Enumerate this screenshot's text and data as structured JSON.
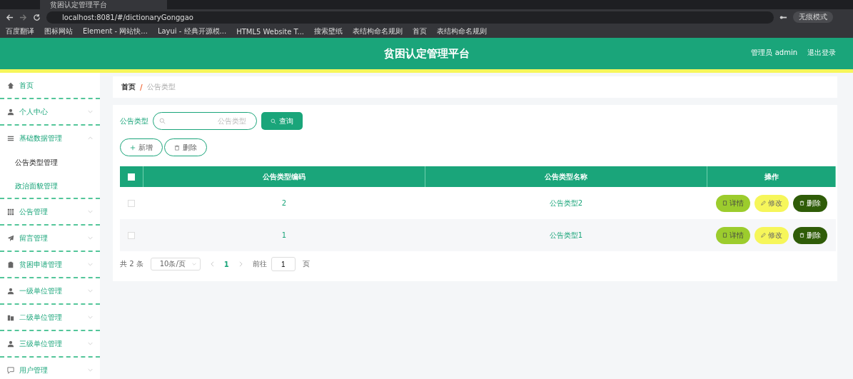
{
  "browser": {
    "tab_title": "贫困认定管理平台",
    "url": "localhost:8081/#/dictionaryGonggao",
    "profile": "无痕模式",
    "bookmarks": [
      "百度翻译",
      "图标网站",
      "Element - 网站快...",
      "Layui - 经典开源模...",
      "HTML5 Website T...",
      "搜索壁纸",
      "表结构命名规则",
      "首页",
      "表结构命名规则"
    ]
  },
  "header": {
    "title": "贫困认定管理平台",
    "user": "管理员 admin",
    "logout": "退出登录"
  },
  "sidebar": {
    "items": [
      {
        "label": "首页",
        "expandable": false,
        "expanded": false
      },
      {
        "label": "个人中心",
        "expandable": true,
        "expanded": false
      },
      {
        "label": "基础数据管理",
        "expandable": true,
        "expanded": true,
        "children": [
          {
            "label": "公告类型管理",
            "selected": true
          },
          {
            "label": "政治面貌管理",
            "selected": false
          }
        ]
      },
      {
        "label": "公告管理",
        "expandable": true,
        "expanded": false
      },
      {
        "label": "留言管理",
        "expandable": true,
        "expanded": false
      },
      {
        "label": "贫困申请管理",
        "expandable": true,
        "expanded": false
      },
      {
        "label": "一级单位管理",
        "expandable": true,
        "expanded": false
      },
      {
        "label": "二级单位管理",
        "expandable": true,
        "expanded": false
      },
      {
        "label": "三级单位管理",
        "expandable": true,
        "expanded": false
      },
      {
        "label": "用户管理",
        "expandable": true,
        "expanded": false
      }
    ]
  },
  "breadcrumb": {
    "separator": "/",
    "items": [
      "首页",
      "公告类型"
    ]
  },
  "search": {
    "label": "公告类型",
    "placeholder": "公告类型",
    "button": "查询"
  },
  "actions": [
    "新增",
    "删除"
  ],
  "table": {
    "header_checked": false,
    "columns": [
      "公告类型编码",
      "公告类型名称",
      "操作"
    ],
    "rows": [
      {
        "checked": false,
        "code": "2",
        "name": "公告类型2",
        "buttons": [
          "详情",
          "修改",
          "删除"
        ]
      },
      {
        "checked": false,
        "code": "1",
        "name": "公告类型1",
        "buttons": [
          "详情",
          "修改",
          "删除"
        ]
      }
    ]
  },
  "pagination": {
    "total": "共 2 条",
    "page_size": "10条/页",
    "pages": [
      {
        "label": "1",
        "selected": true
      }
    ],
    "goto_label": "前往",
    "goto_value": "1",
    "goto_suffix": "页"
  }
}
